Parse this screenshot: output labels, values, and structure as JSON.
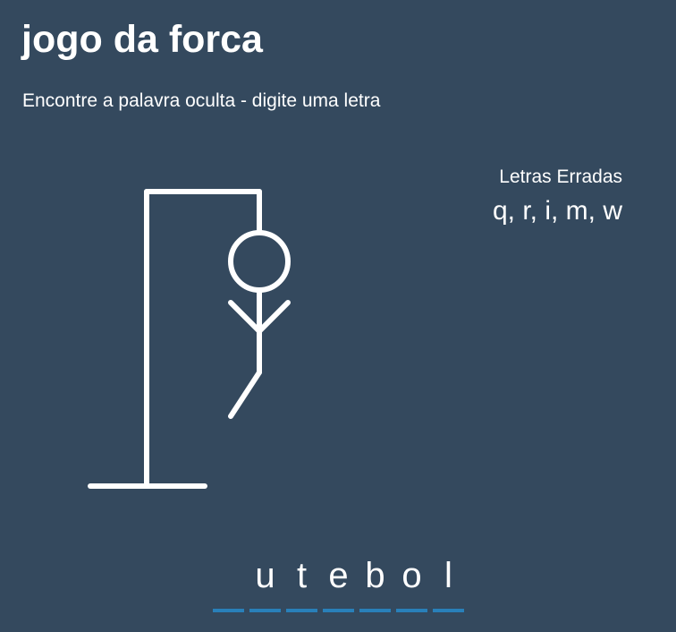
{
  "title": "jogo da forca",
  "subtitle": "Encontre a palavra oculta - digite uma letra",
  "wrong": {
    "label": "Letras Erradas",
    "letters": "q, r, i, m, w"
  },
  "word": {
    "letters": [
      "",
      "u",
      "t",
      "e",
      "b",
      "o",
      "l"
    ]
  },
  "colors": {
    "background": "#34495e",
    "underline": "#2980b9",
    "figure": "#ffffff"
  }
}
